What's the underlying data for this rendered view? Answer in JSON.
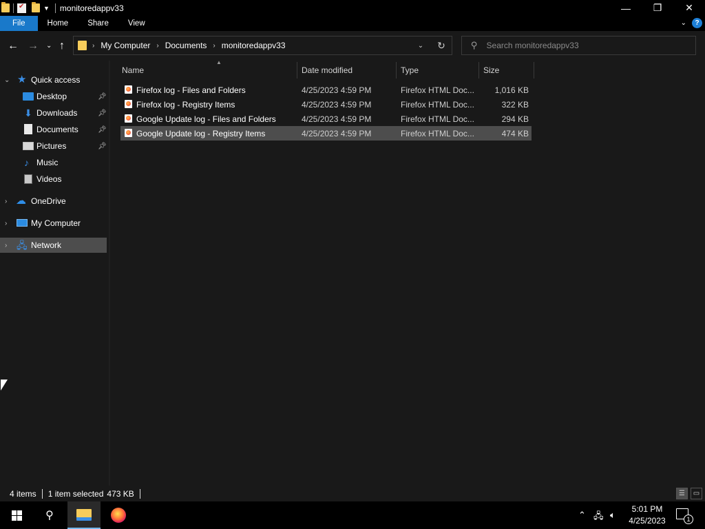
{
  "window": {
    "title": "monitoredappv33",
    "controls": {
      "minimize": "—",
      "maximize": "❐",
      "close": "✕"
    }
  },
  "ribbon": {
    "tabs": [
      "File",
      "Home",
      "Share",
      "View"
    ],
    "help": "?"
  },
  "address": {
    "crumbs": [
      "My Computer",
      "Documents",
      "monitoredappv33"
    ]
  },
  "search": {
    "placeholder": "Search monitoredappv33"
  },
  "nav": {
    "quick_access": "Quick access",
    "pinned": [
      {
        "label": "Desktop",
        "icon": "desktop-icon",
        "pinned": true
      },
      {
        "label": "Downloads",
        "icon": "downloads-icon",
        "pinned": true
      },
      {
        "label": "Documents",
        "icon": "documents-icon",
        "pinned": true
      },
      {
        "label": "Pictures",
        "icon": "pictures-icon",
        "pinned": true
      },
      {
        "label": "Music",
        "icon": "music-icon",
        "pinned": false
      },
      {
        "label": "Videos",
        "icon": "videos-icon",
        "pinned": false
      }
    ],
    "roots": [
      "OneDrive",
      "My Computer",
      "Network"
    ],
    "selected": "Network"
  },
  "columns": {
    "name": "Name",
    "date": "Date modified",
    "type": "Type",
    "size": "Size"
  },
  "files": [
    {
      "name": "Firefox log - Files and Folders",
      "date": "4/25/2023 4:59 PM",
      "type": "Firefox HTML Doc...",
      "size": "1,016 KB"
    },
    {
      "name": "Firefox log - Registry Items",
      "date": "4/25/2023 4:59 PM",
      "type": "Firefox HTML Doc...",
      "size": "322 KB"
    },
    {
      "name": "Google Update log - Files and Folders",
      "date": "4/25/2023 4:59 PM",
      "type": "Firefox HTML Doc...",
      "size": "294 KB"
    },
    {
      "name": "Google Update log - Registry Items",
      "date": "4/25/2023 4:59 PM",
      "type": "Firefox HTML Doc...",
      "size": "474 KB"
    }
  ],
  "status": {
    "count": "4 items",
    "selection": "1 item selected",
    "selection_size": "473 KB"
  },
  "taskbar": {
    "time": "5:01 PM",
    "date": "4/25/2023",
    "notifications": "1"
  },
  "colors": {
    "accent": "#1979ca",
    "selection": "#4d4d4d",
    "background": "#191919",
    "folder": "#f6cc5b"
  }
}
